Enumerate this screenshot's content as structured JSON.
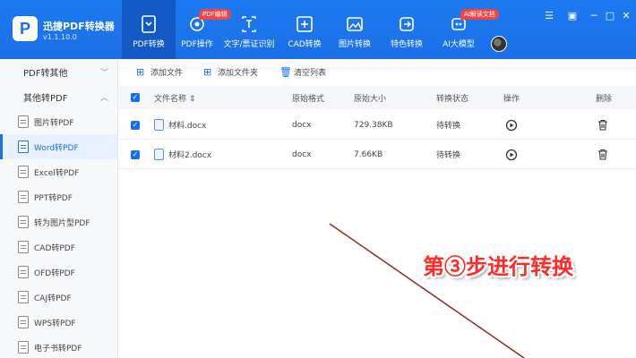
{
  "app": {
    "title": "迅捷PDF转换器",
    "version": "v1.1.10.0",
    "logo_letter": "P"
  },
  "nav": {
    "tabs": [
      {
        "label": "PDF转换",
        "icon": "pdf-convert-icon",
        "active": true
      },
      {
        "label": "PDF操作",
        "icon": "pdf-operate-icon",
        "badge": "PDF编辑"
      },
      {
        "label": "文字/票证识别",
        "icon": "text-recognize-icon"
      },
      {
        "label": "CAD转换",
        "icon": "cad-convert-icon"
      },
      {
        "label": "图片转换",
        "icon": "image-convert-icon"
      },
      {
        "label": "特色转换",
        "icon": "special-convert-icon"
      },
      {
        "label": "AI大模型",
        "icon": "ai-model-icon",
        "badge": "AI解读文档"
      }
    ]
  },
  "sidebar": {
    "sections": [
      {
        "label": "PDF转其他",
        "chevron": "﹀"
      },
      {
        "label": "其他转PDF",
        "chevron": "︿"
      }
    ],
    "items": [
      {
        "label": "图片转PDF"
      },
      {
        "label": "Word转PDF",
        "active": true
      },
      {
        "label": "Excel转PDF"
      },
      {
        "label": "PPT转PDF"
      },
      {
        "label": "转为图片型PDF"
      },
      {
        "label": "CAD转PDF"
      },
      {
        "label": "OFD转PDF"
      },
      {
        "label": "CAJ转PDF"
      },
      {
        "label": "WPS转PDF"
      },
      {
        "label": "电子书转PDF"
      }
    ]
  },
  "toolbar": {
    "add_file": "添加文件",
    "add_folder": "添加文件夹",
    "clear_list": "清空列表"
  },
  "table": {
    "headers": {
      "name": "文件名称 ⇕",
      "format": "原始格式",
      "size": "原始大小",
      "status": "转换状态",
      "action": "操作",
      "delete": "删除"
    },
    "rows": [
      {
        "name": "材料.docx",
        "format": "docx",
        "size": "729.38KB",
        "status": "待转换"
      },
      {
        "name": "材料2.docx",
        "format": "docx",
        "size": "7.66KB",
        "status": "待转换"
      }
    ]
  },
  "annotation": {
    "text": "第③步进行转换",
    "color": "#ff2a2a"
  },
  "colors": {
    "accent": "#1b6fe6",
    "badge": "#f04545"
  }
}
